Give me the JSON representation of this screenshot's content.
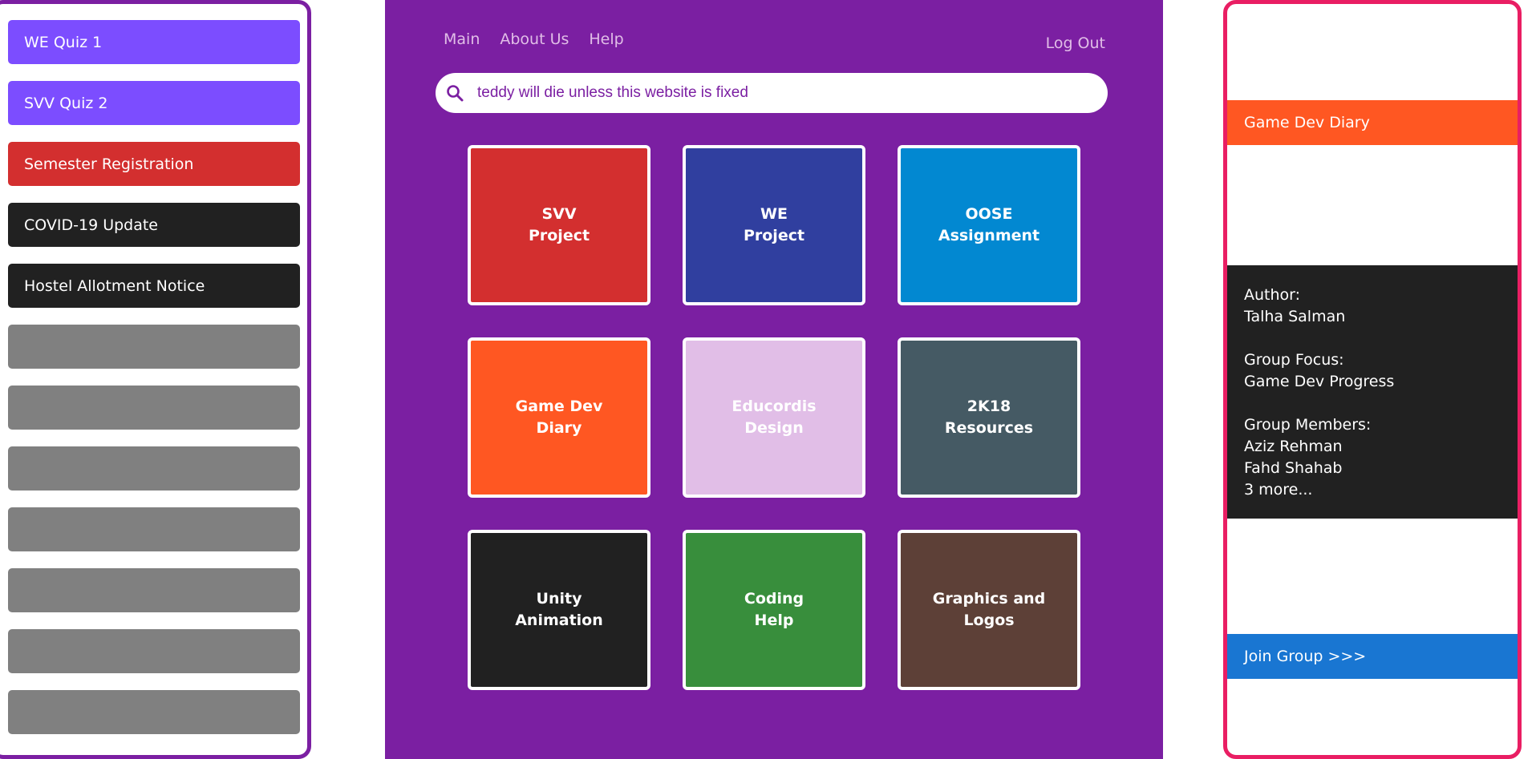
{
  "left_panel": {
    "items": [
      {
        "label": "WE Quiz 1",
        "color": "#7c4dff"
      },
      {
        "label": "SVV Quiz 2",
        "color": "#7c4dff"
      },
      {
        "label": "Semester Registration",
        "color": "#d32f2f"
      },
      {
        "label": "COVID-19 Update",
        "color": "#212121"
      },
      {
        "label": "Hostel Allotment Notice",
        "color": "#212121"
      },
      {
        "label": "",
        "color": "#808080"
      },
      {
        "label": "",
        "color": "#808080"
      },
      {
        "label": "",
        "color": "#808080"
      },
      {
        "label": "",
        "color": "#808080"
      },
      {
        "label": "",
        "color": "#808080"
      },
      {
        "label": "",
        "color": "#808080"
      },
      {
        "label": "",
        "color": "#808080"
      }
    ]
  },
  "nav": {
    "main": "Main",
    "about": "About Us",
    "help": "Help",
    "logout": "Log Out"
  },
  "search": {
    "value": "teddy will die unless this website is fixed",
    "icon": "search-icon"
  },
  "tiles": [
    {
      "label": "SVV\nProject",
      "color": "#d32f2f",
      "text_color": "#ffffff"
    },
    {
      "label": "WE\nProject",
      "color": "#303f9f",
      "text_color": "#ffffff"
    },
    {
      "label": "OOSE\nAssignment",
      "color": "#0288d1",
      "text_color": "#ffffff"
    },
    {
      "label": "Game Dev\nDiary",
      "color": "#ff5722",
      "text_color": "#ffffff"
    },
    {
      "label": "Educordis\nDesign",
      "color": "#e1bee7",
      "text_color": "#ffffff"
    },
    {
      "label": "2K18\nResources",
      "color": "#455a64",
      "text_color": "#ffffff"
    },
    {
      "label": "Unity\nAnimation",
      "color": "#212121",
      "text_color": "#ffffff"
    },
    {
      "label": "Coding\nHelp",
      "color": "#388e3c",
      "text_color": "#ffffff"
    },
    {
      "label": "Graphics and\nLogos",
      "color": "#5d4037",
      "text_color": "#ffffff"
    }
  ],
  "right_panel": {
    "title": "Game Dev Diary",
    "author_label": "Author:",
    "author": "Talha Salman",
    "focus_label": "Group Focus:",
    "focus": "Game Dev Progress",
    "members_label": "Group Members:",
    "members": [
      "Aziz Rehman",
      "Fahd Shahab"
    ],
    "more": "3 more...",
    "join": "Join Group >>>"
  },
  "colors": {
    "primary": "#7b1fa2",
    "right_border": "#e91e63"
  }
}
